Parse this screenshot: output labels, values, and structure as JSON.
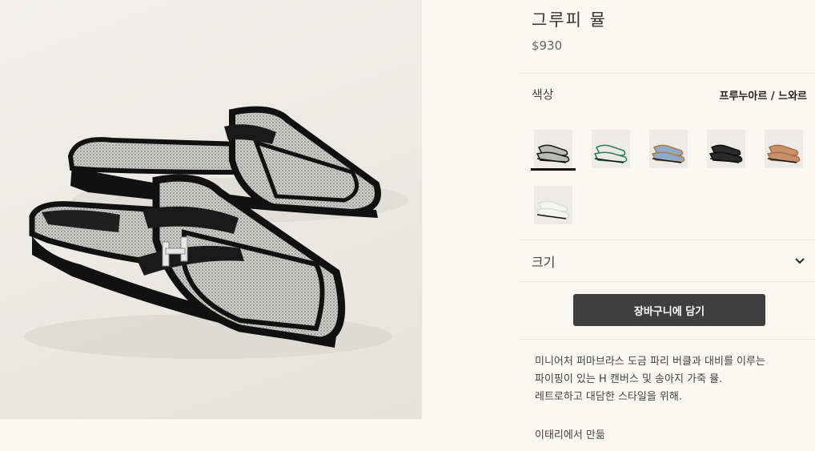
{
  "product": {
    "name": "그루피 뮬",
    "price": "$930",
    "image_alt": "Groupie mule pair photo"
  },
  "color": {
    "label": "색상",
    "selected": "프루누아르 / 느와르",
    "swatches": [
      {
        "name": "grey-black",
        "body": "#b9bab8",
        "trim": "#1a1a1a"
      },
      {
        "name": "white-green",
        "body": "#e8e8e6",
        "trim": "#2f7d4f"
      },
      {
        "name": "blue-tan",
        "body": "#8fa9c8",
        "trim": "#b07a46"
      },
      {
        "name": "black",
        "body": "#2a2a2a",
        "trim": "#0f0f0f"
      },
      {
        "name": "camel",
        "body": "#c9916a",
        "trim": "#a86c45"
      },
      {
        "name": "white",
        "body": "#f4f4f2",
        "trim": "#dcdcdc"
      }
    ]
  },
  "size": {
    "label": "크기"
  },
  "cart": {
    "button_label": "장바구니에 담기"
  },
  "description": {
    "line1": "미니어처 퍼마브라스 도금 파리 버클과 대비를 이루는",
    "line2": "파이핑이 있는 H 캔버스 및 송아지 가죽 뮬.",
    "line3": "레트로하고 대담한 스타일을 위해.",
    "origin": "이태리에서 만듦"
  },
  "colors": {
    "background": "#f9f7f2",
    "button": "#3f3f3f",
    "divider": "#e7e4dd"
  }
}
